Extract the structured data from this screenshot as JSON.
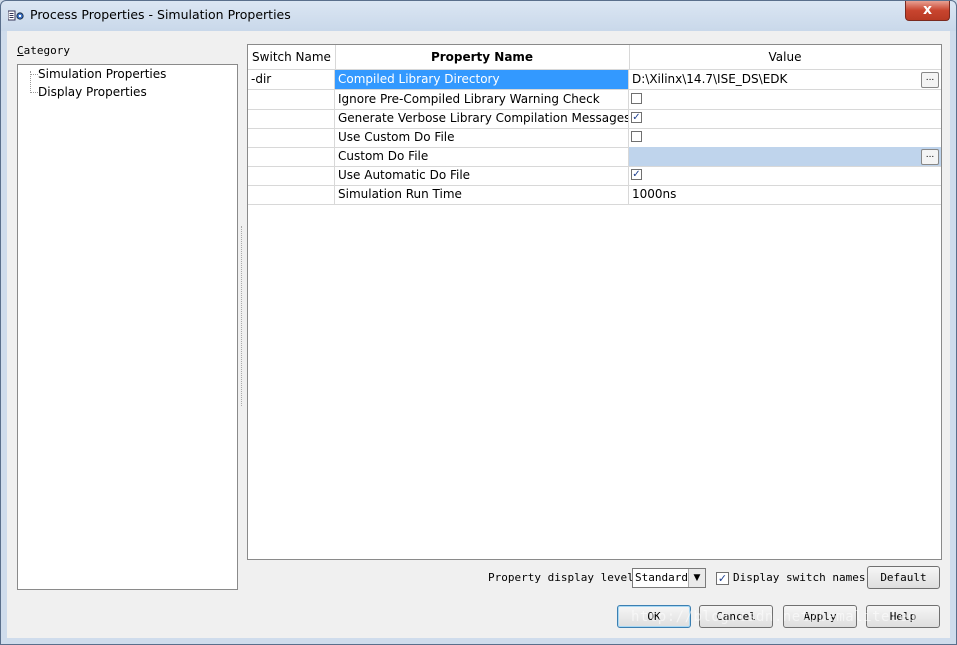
{
  "window": {
    "title": "Process Properties - Simulation Properties",
    "close_glyph": "x"
  },
  "category": {
    "label_first": "C",
    "label_rest": "ategory",
    "items": [
      {
        "label": "Simulation Properties"
      },
      {
        "label": "Display Properties"
      }
    ]
  },
  "grid": {
    "headers": {
      "switch": "Switch Name",
      "property": "Property Name",
      "value": "Value"
    },
    "rows": [
      {
        "switch": "-dir",
        "property": "Compiled Library Directory",
        "value": "D:\\Xilinx\\14.7\\ISE_DS\\EDK",
        "kind": "text",
        "selected": true,
        "browse": true
      },
      {
        "switch": "",
        "property": "Ignore Pre-Compiled Library Warning Check",
        "value": "",
        "kind": "checkbox",
        "checked": false
      },
      {
        "switch": "",
        "property": "Generate Verbose Library Compilation Messages",
        "value": "",
        "kind": "checkbox",
        "checked": true
      },
      {
        "switch": "",
        "property": "Use Custom Do File",
        "value": "",
        "kind": "checkbox",
        "checked": false
      },
      {
        "switch": "",
        "property": "Custom Do File",
        "value": "",
        "kind": "text",
        "highlight": true,
        "browse": true
      },
      {
        "switch": "",
        "property": "Use Automatic Do File",
        "value": "",
        "kind": "checkbox",
        "checked": true
      },
      {
        "switch": "",
        "property": "Simulation Run Time",
        "value": "1000ns",
        "kind": "text"
      }
    ],
    "browse_label": "..."
  },
  "footer": {
    "display_level_label": "Property display level:",
    "display_level_value": "Standard",
    "display_switch_label": "Display switch names",
    "display_switch_checked": true,
    "default_label": "Default",
    "ok_label": "OK",
    "cancel_label": "Cancel",
    "apply_label": "Apply",
    "help_label": "Help"
  },
  "watermark": "http://blog.csdn.net/bemaliteleo",
  "icons": {
    "check": "✓",
    "dropdown": "▼"
  }
}
